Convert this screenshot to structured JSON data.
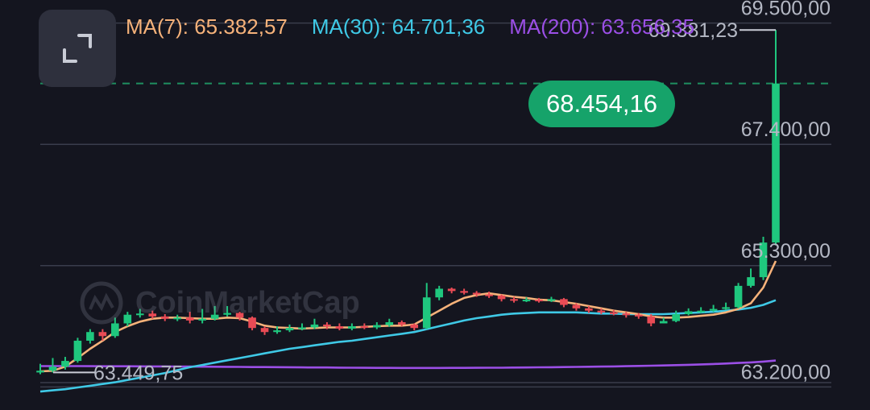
{
  "legend": {
    "ma7": {
      "label": "MA(7): 65.382,57",
      "color": "#f6b27a"
    },
    "ma30": {
      "label": "MA(30): 64.701,36",
      "color": "#3fc9e6"
    },
    "ma200": {
      "label": "MA(200): 63.656,35",
      "color": "#9b4fe6"
    }
  },
  "current_price": {
    "label": "68.454,16",
    "value": 68454.16,
    "color": "#16a36a"
  },
  "watermark": "CoinMarketCap",
  "chart_data": {
    "type": "candlestick",
    "ylim": [
      62800,
      69900
    ],
    "y_ticks": [
      {
        "value": 69500,
        "label": "69.500,00"
      },
      {
        "value": 67400,
        "label": "67.400,00"
      },
      {
        "value": 65300,
        "label": "65.300,00"
      },
      {
        "value": 63200,
        "label": "63.200,00"
      }
    ],
    "high_marker": {
      "value": 69381.23,
      "label": "69.381,23"
    },
    "low_marker": {
      "value": 63449.75,
      "label": "63.449,75"
    },
    "candles": [
      [
        63450,
        63480,
        63600,
        63420
      ],
      [
        63480,
        63550,
        63700,
        63450
      ],
      [
        63550,
        63650,
        63720,
        63500
      ],
      [
        63650,
        64000,
        64050,
        63620
      ],
      [
        64000,
        64150,
        64200,
        63950
      ],
      [
        64150,
        64080,
        64200,
        64000
      ],
      [
        64080,
        64300,
        64400,
        64050
      ],
      [
        64300,
        64450,
        64500,
        64250
      ],
      [
        64450,
        64470,
        64550,
        64400
      ],
      [
        64470,
        64420,
        64520,
        64380
      ],
      [
        64420,
        64380,
        64460,
        64340
      ],
      [
        64380,
        64400,
        64450,
        64340
      ],
      [
        64400,
        64350,
        64500,
        64300
      ],
      [
        64350,
        64380,
        64550,
        64300
      ],
      [
        64380,
        64450,
        64600,
        64350
      ],
      [
        64450,
        64480,
        64600,
        64420
      ],
      [
        64480,
        64400,
        64500,
        64350
      ],
      [
        64400,
        64220,
        64420,
        64180
      ],
      [
        64220,
        64150,
        64250,
        64100
      ],
      [
        64150,
        64180,
        64250,
        64120
      ],
      [
        64180,
        64220,
        64280,
        64150
      ],
      [
        64220,
        64230,
        64300,
        64180
      ],
      [
        64230,
        64280,
        64380,
        64200
      ],
      [
        64280,
        64250,
        64320,
        64200
      ],
      [
        64250,
        64210,
        64300,
        64180
      ],
      [
        64210,
        64250,
        64300,
        64180
      ],
      [
        64250,
        64230,
        64300,
        64200
      ],
      [
        64230,
        64270,
        64320,
        64200
      ],
      [
        64270,
        64320,
        64380,
        64240
      ],
      [
        64320,
        64280,
        64350,
        64250
      ],
      [
        64280,
        64220,
        64300,
        64180
      ],
      [
        64220,
        64750,
        65000,
        64200
      ],
      [
        64750,
        64900,
        64950,
        64700
      ],
      [
        64900,
        64860,
        64920,
        64820
      ],
      [
        64860,
        64830,
        64900,
        64800
      ],
      [
        64830,
        64800,
        64860,
        64760
      ],
      [
        64800,
        64780,
        64850,
        64740
      ],
      [
        64780,
        64720,
        64800,
        64680
      ],
      [
        64720,
        64700,
        64760,
        64660
      ],
      [
        64700,
        64710,
        64750,
        64670
      ],
      [
        64710,
        64690,
        64740,
        64660
      ],
      [
        64690,
        64720,
        64760,
        64670
      ],
      [
        64720,
        64620,
        64740,
        64580
      ],
      [
        64620,
        64560,
        64650,
        64520
      ],
      [
        64560,
        64520,
        64600,
        64480
      ],
      [
        64520,
        64490,
        64560,
        64460
      ],
      [
        64490,
        64470,
        64530,
        64440
      ],
      [
        64470,
        64450,
        64500,
        64400
      ],
      [
        64450,
        64420,
        64480,
        64380
      ],
      [
        64420,
        64300,
        64460,
        64250
      ],
      [
        64300,
        64340,
        64400,
        64300
      ],
      [
        64340,
        64460,
        64520,
        64320
      ],
      [
        64460,
        64510,
        64560,
        64440
      ],
      [
        64510,
        64520,
        64580,
        64480
      ],
      [
        64520,
        64550,
        64620,
        64500
      ],
      [
        64550,
        64580,
        64660,
        64530
      ],
      [
        64580,
        64950,
        65000,
        64560
      ],
      [
        64950,
        65100,
        65250,
        64920
      ],
      [
        65100,
        65700,
        65800,
        65050
      ],
      [
        65700,
        68454,
        69381,
        65650
      ]
    ],
    "ma7": [
      63470,
      63480,
      63550,
      63700,
      63860,
      64000,
      64150,
      64250,
      64330,
      64380,
      64400,
      64400,
      64390,
      64380,
      64380,
      64400,
      64390,
      64330,
      64260,
      64230,
      64220,
      64210,
      64220,
      64230,
      64230,
      64230,
      64240,
      64250,
      64260,
      64260,
      64280,
      64400,
      64520,
      64640,
      64740,
      64790,
      64820,
      64790,
      64760,
      64740,
      64710,
      64700,
      64670,
      64640,
      64600,
      64560,
      64520,
      64490,
      64460,
      64420,
      64400,
      64400,
      64410,
      64430,
      64450,
      64490,
      64550,
      64650,
      64920,
      65380
    ],
    "ma30": [
      63120,
      63140,
      63160,
      63190,
      63220,
      63250,
      63280,
      63320,
      63360,
      63400,
      63440,
      63490,
      63540,
      63580,
      63620,
      63660,
      63700,
      63740,
      63780,
      63820,
      63860,
      63890,
      63920,
      63950,
      63980,
      64000,
      64030,
      64060,
      64090,
      64120,
      64150,
      64200,
      64250,
      64300,
      64350,
      64390,
      64420,
      64450,
      64470,
      64480,
      64490,
      64490,
      64490,
      64490,
      64480,
      64470,
      64470,
      64460,
      64460,
      64460,
      64460,
      64470,
      64480,
      64490,
      64500,
      64520,
      64540,
      64570,
      64620,
      64701
    ],
    "ma200": [
      63560,
      63560,
      63560,
      63560,
      63559,
      63558,
      63558,
      63557,
      63556,
      63555,
      63554,
      63553,
      63552,
      63550,
      63549,
      63548,
      63546,
      63544,
      63543,
      63542,
      63540,
      63538,
      63537,
      63536,
      63534,
      63532,
      63531,
      63530,
      63529,
      63528,
      63528,
      63528,
      63528,
      63529,
      63530,
      63531,
      63532,
      63533,
      63535,
      63537,
      63539,
      63541,
      63543,
      63546,
      63549,
      63552,
      63555,
      63559,
      63563,
      63567,
      63572,
      63577,
      63583,
      63590,
      63597,
      63605,
      63614,
      63624,
      63638,
      63656
    ]
  }
}
